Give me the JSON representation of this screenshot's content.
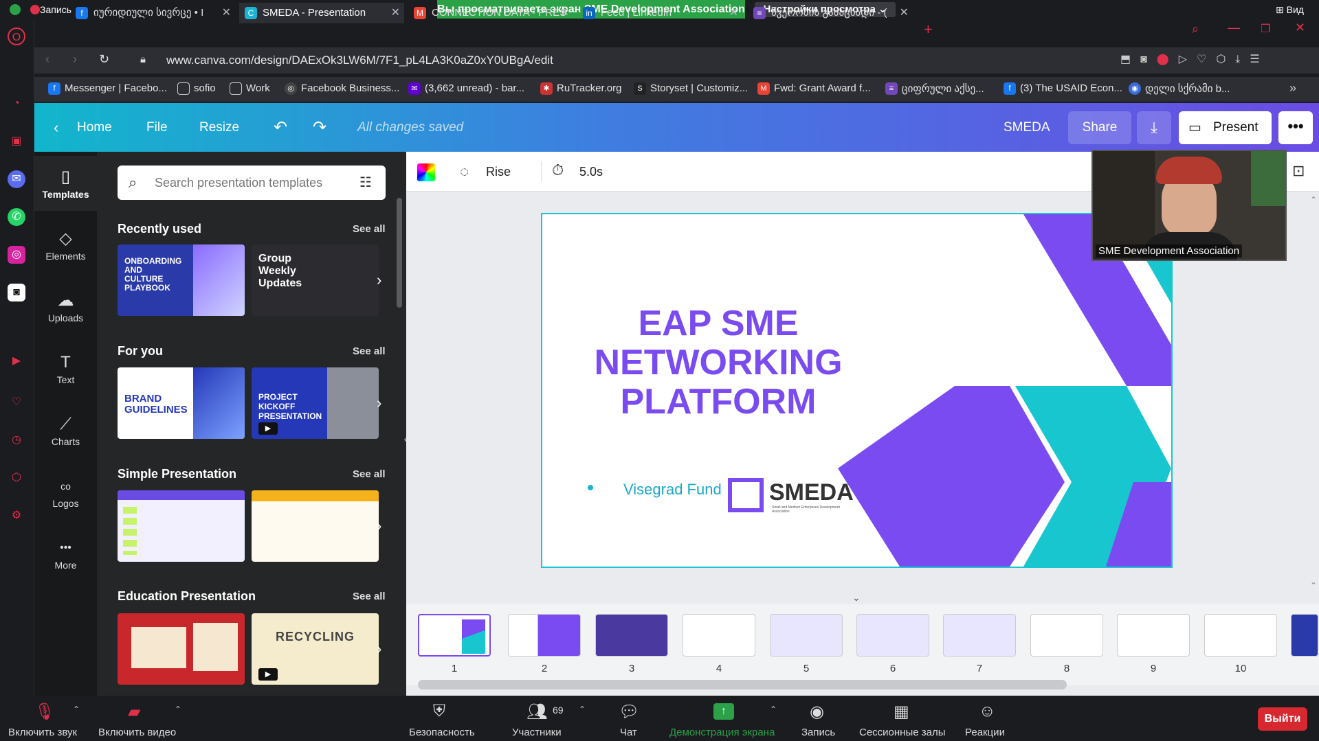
{
  "zoom": {
    "recording": "Запись",
    "banner": "Вы просматриваете экран SME Development Association",
    "view_settings": "Настройки просмотра",
    "view_settings_chevron": "⌄",
    "view": "Вид",
    "video_name": "SME Development Association",
    "bottom": {
      "mute": "Включить звук",
      "video": "Включить видео",
      "security": "Безопасность",
      "participants": "Участники",
      "participants_count": "69",
      "chat": "Чат",
      "share": "Демонстрация экрана",
      "record": "Запись",
      "breakout": "Сессионные залы",
      "reactions": "Реакции",
      "leave": "Выйти"
    }
  },
  "browser": {
    "tabs": [
      {
        "label": "იურიდიული სივრცე • I",
        "icon": "facebook-icon",
        "color": "#1877f2"
      },
      {
        "label": "SMEDA - Presentation",
        "icon": "canva-icon",
        "color": "#19b5d3"
      },
      {
        "label": "CONNECTION DATA - PRES",
        "icon": "gmail-icon",
        "color": "#ea4335"
      },
      {
        "label": "Feed | LinkedIn",
        "icon": "linkedin-icon",
        "color": "#0a66c2"
      },
      {
        "label": "წვერობის განაცხადი - (",
        "icon": "forms-icon",
        "color": "#7248b9"
      }
    ],
    "url": "www.canva.com/design/DAExOk3LW6M/7F1_pL4LA3K0aZ0xY0UBgA/edit",
    "bookmarks": [
      {
        "label": "Messenger | Facebo...",
        "color": "#1877f2"
      },
      {
        "label": "sofio",
        "color": "#555"
      },
      {
        "label": "Work",
        "color": "#555"
      },
      {
        "label": "Facebook Business...",
        "color": "#444"
      },
      {
        "label": "(3,662 unread) - bar...",
        "color": "#5f01d1"
      },
      {
        "label": "RuTracker.org",
        "color": "#c33"
      },
      {
        "label": "Storyset | Customiz...",
        "color": "#222"
      },
      {
        "label": "Fwd: Grant Award f...",
        "color": "#ea4335"
      },
      {
        "label": "ციფრული აქსე...",
        "color": "#7248b9"
      },
      {
        "label": "(3) The USAID Econ...",
        "color": "#1877f2"
      },
      {
        "label": "დელი სქრამი b...",
        "color": "#3a6bd8"
      }
    ]
  },
  "canva": {
    "header": {
      "home": "Home",
      "file": "File",
      "resize": "Resize",
      "saved": "All changes saved",
      "team": "SMEDA",
      "share": "Share",
      "present": "Present",
      "more": "•••"
    },
    "nav": [
      {
        "label": "Templates",
        "icon": "▯"
      },
      {
        "label": "Elements",
        "icon": "◇"
      },
      {
        "label": "Uploads",
        "icon": "☁"
      },
      {
        "label": "Text",
        "icon": "T"
      },
      {
        "label": "Charts",
        "icon": "⟋"
      },
      {
        "label": "Logos",
        "icon": "co"
      },
      {
        "label": "More",
        "icon": "•••"
      }
    ],
    "search_placeholder": "Search presentation templates",
    "see_all": "See all",
    "sections": [
      {
        "title": "Recently used",
        "thumbs": [
          {
            "text": "ONBOARDING AND CULTURE PLAYBOOK",
            "bg": "#2a3aa8"
          },
          {
            "text": "Group Weekly Updates",
            "bg": "#2c2c30"
          }
        ]
      },
      {
        "title": "For you",
        "thumbs": [
          {
            "text": "BRAND GUIDELINES",
            "bg": "#ffffff"
          },
          {
            "text": "PROJECT KICKOFF PRESENTATION",
            "bg": "#2438b8"
          }
        ]
      },
      {
        "title": "Simple Presentation",
        "thumbs": [
          {
            "text": "",
            "bg": "#f2f0ff"
          },
          {
            "text": "",
            "bg": "#fffaf0"
          }
        ]
      },
      {
        "title": "Education Presentation",
        "thumbs": [
          {
            "text": "",
            "bg": "#c8272c"
          },
          {
            "text": "RECYCLING",
            "bg": "#f4eccd"
          }
        ]
      }
    ],
    "toolbar": {
      "animation": "Rise",
      "duration": "5.0s"
    },
    "slide": {
      "title": "EAP SME NETWORKING PLATFORM",
      "partner": "Visegrad Fund",
      "logo": "SMEDA",
      "logo_sub": "Small and Medium Enterprises Development Association"
    },
    "pages": [
      "1",
      "2",
      "3",
      "4",
      "5",
      "6",
      "7",
      "8",
      "9",
      "10"
    ]
  },
  "colors": {
    "purple": "#7a4bf0",
    "teal": "#18c6d0"
  }
}
